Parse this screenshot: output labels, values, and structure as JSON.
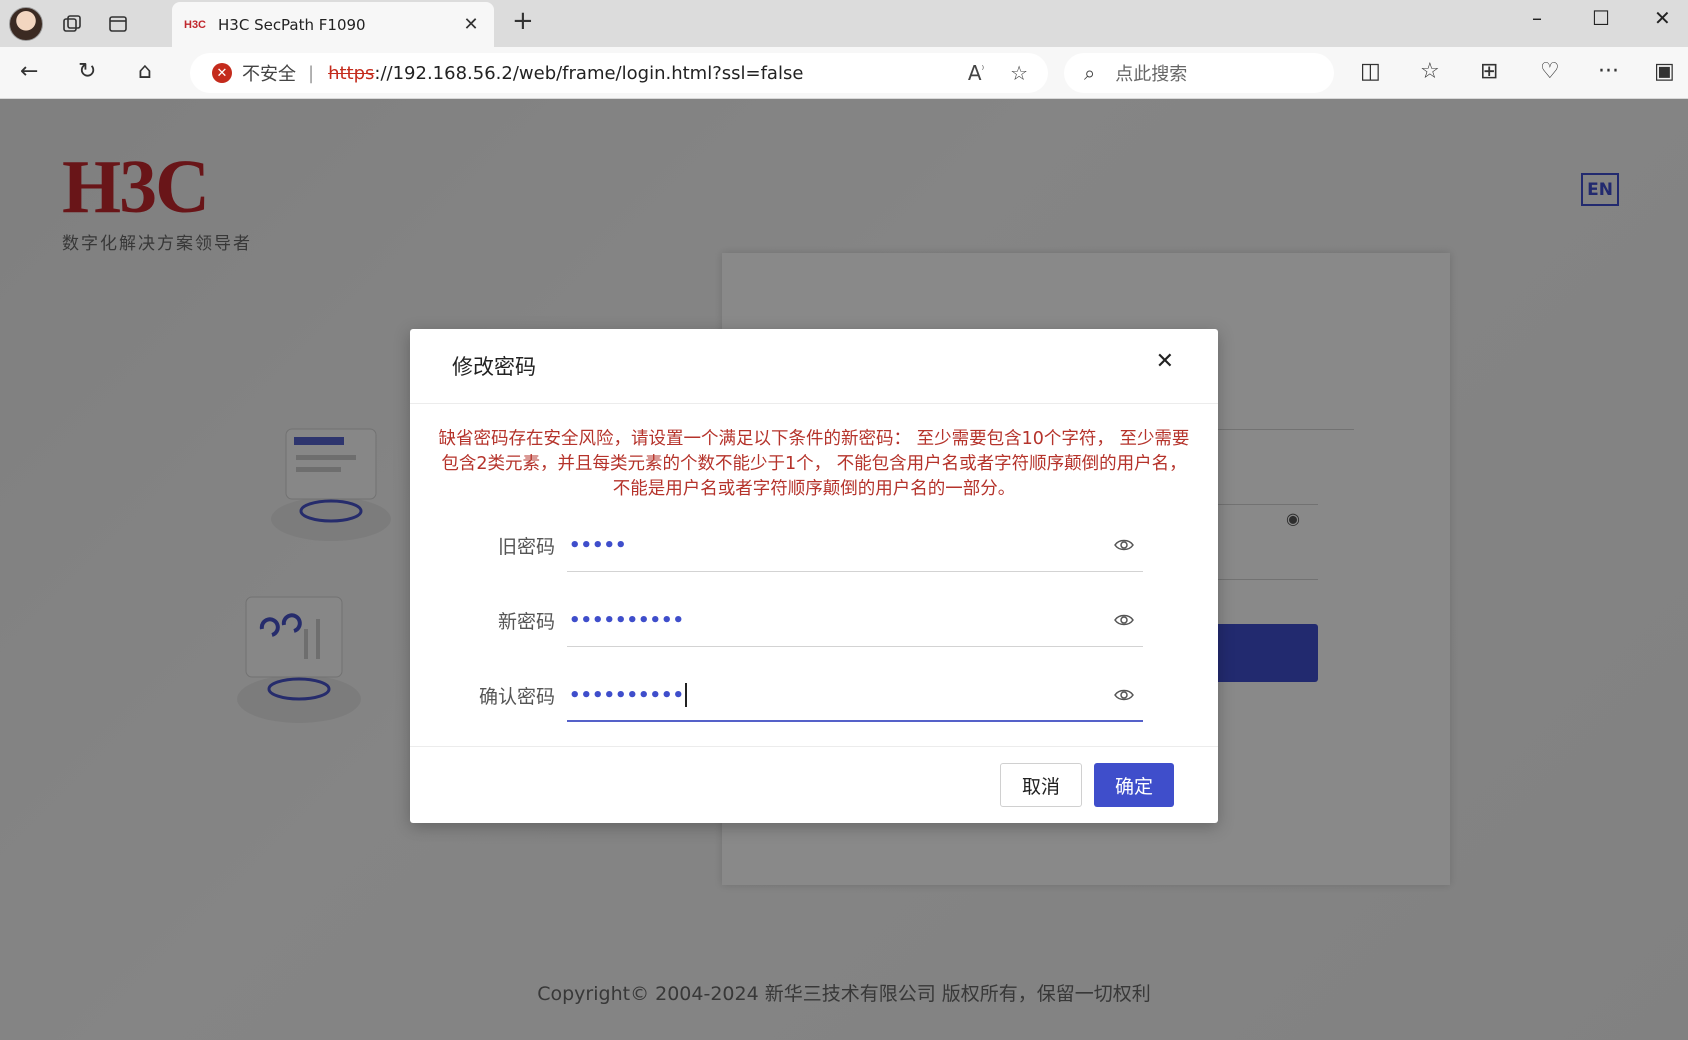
{
  "browser": {
    "tab": {
      "favicon_text": "H3C",
      "title": "H3C SecPath F1090"
    },
    "address": {
      "security_label": "不安全",
      "url_scheme": "https",
      "url_rest": "://192.168.56.2/web/frame/login.html?ssl=false"
    },
    "search": {
      "placeholder": "点此搜索"
    }
  },
  "page": {
    "logo_text": "H3C",
    "logo_tagline": "数字化解决方案领导者",
    "language_button": "EN",
    "copyright": "Copyright© 2004-2024 新华三技术有限公司 版权所有，保留一切权利"
  },
  "modal": {
    "title": "修改密码",
    "warning": "缺省密码存在安全风险，请设置一个满足以下条件的新密码： 至少需要包含10个字符， 至少需要包含2类元素，并且每类元素的个数不能少于1个， 不能包含用户名或者字符顺序颠倒的用户名， 不能是用户名或者字符顺序颠倒的用户名的一部分。",
    "fields": [
      {
        "label": "旧密码",
        "masked_value": "•••••"
      },
      {
        "label": "新密码",
        "masked_value": "••••••••••"
      },
      {
        "label": "确认密码",
        "masked_value": "••••••••••"
      }
    ],
    "cancel_label": "取消",
    "confirm_label": "确定"
  },
  "colors": {
    "primary": "#3f4ecb",
    "warning_text": "#b5332b",
    "brand_red": "#c0272d"
  }
}
